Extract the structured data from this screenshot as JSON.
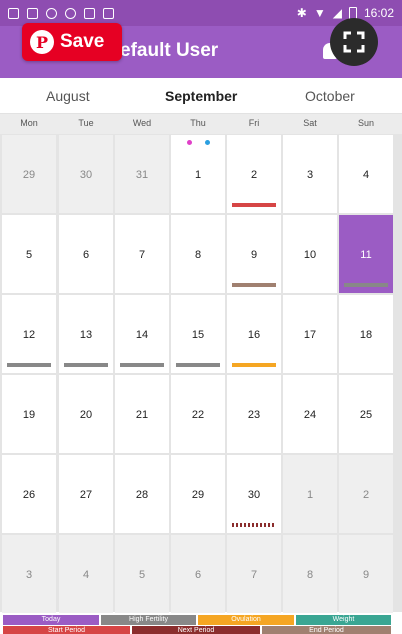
{
  "status_bar": {
    "time": "16:02"
  },
  "app_bar": {
    "title": "My Diary - Default User",
    "title_visible": "efault User",
    "save_label": "Save",
    "pin_glyph": "P"
  },
  "month_nav": {
    "prev": "August",
    "current": "September",
    "next": "October"
  },
  "weekdays": [
    "Mon",
    "Tue",
    "Wed",
    "Thu",
    "Fri",
    "Sat",
    "Sun"
  ],
  "weeks": [
    [
      "29",
      "30",
      "31",
      "1",
      "2",
      "3",
      "4"
    ],
    [
      "5",
      "6",
      "7",
      "8",
      "9",
      "10",
      "11"
    ],
    [
      "12",
      "13",
      "14",
      "15",
      "16",
      "17",
      "18"
    ],
    [
      "19",
      "20",
      "21",
      "22",
      "23",
      "24",
      "25"
    ],
    [
      "26",
      "27",
      "28",
      "29",
      "30",
      "1",
      "2"
    ],
    [
      "3",
      "4",
      "5",
      "6",
      "7",
      "8",
      "9"
    ]
  ],
  "colors": {
    "primary": "#9b5cc4",
    "status": "#8e4db1",
    "red": "#d64545",
    "grey": "#888888",
    "brown": "#a08070",
    "orange": "#f5a623",
    "teal": "#3aa693",
    "pink": "#e040c8",
    "blue": "#2a9fe0",
    "darkred": "#8b2d2d"
  },
  "legend": {
    "today": "Today",
    "high_fertility": "High Fertility",
    "ovulation": "Ovulation",
    "weight": "Weight",
    "start_period": "Start Period",
    "next_period": "Next Period",
    "end_period": "End Period"
  }
}
